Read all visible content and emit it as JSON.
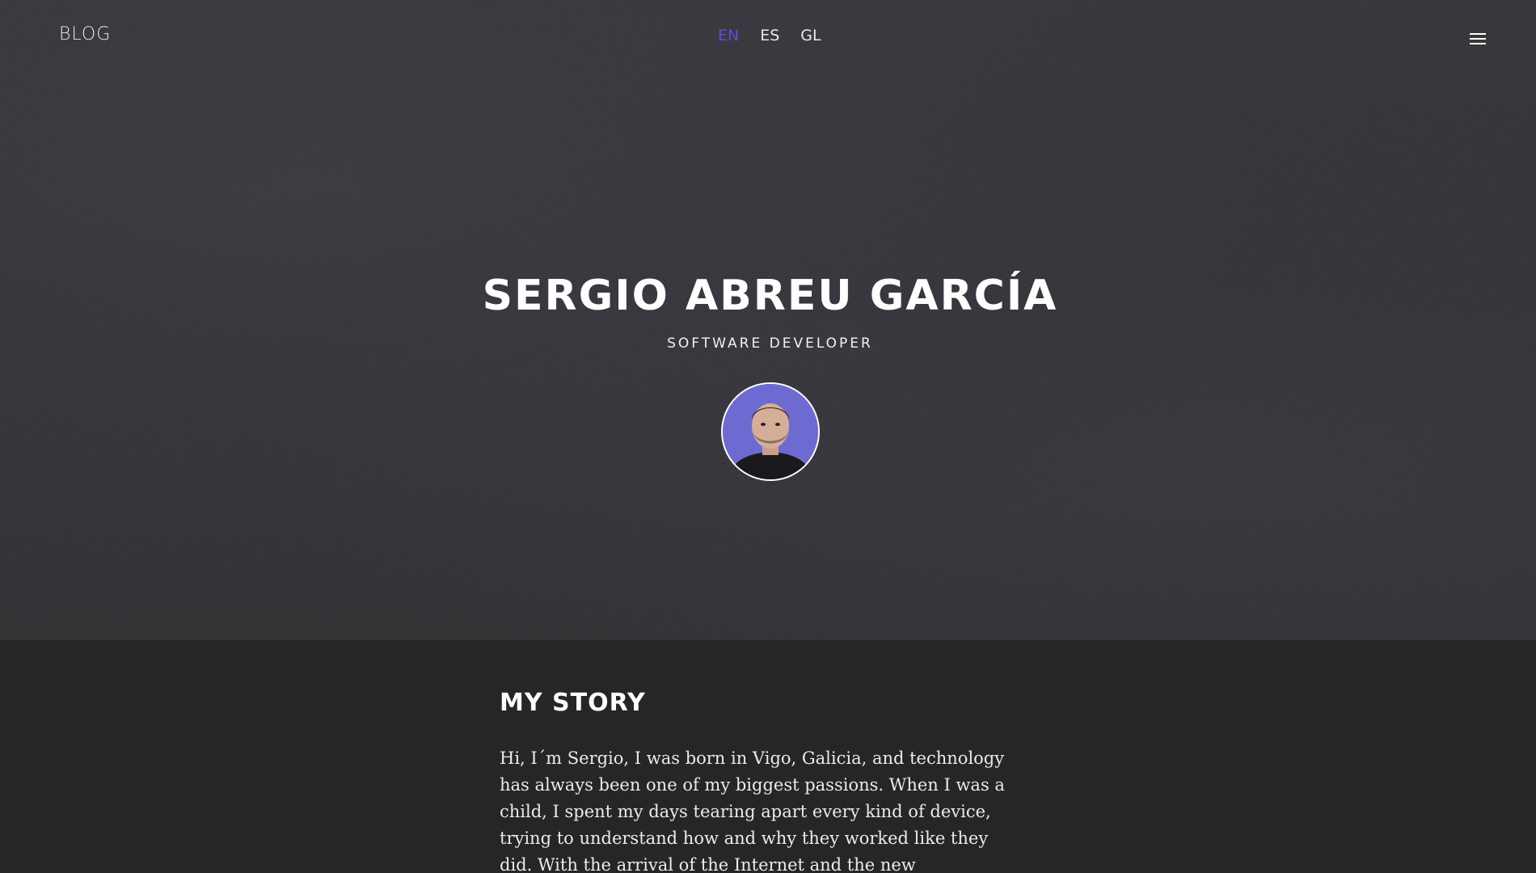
{
  "nav": {
    "logo": "BLOG",
    "languages": [
      "EN",
      "ES",
      "GL"
    ],
    "active_language": "EN",
    "menu_icon": "hamburger-menu-icon"
  },
  "hero": {
    "title": "SERGIO ABREU GARCÍA",
    "subtitle": "SOFTWARE DEVELOPER"
  },
  "story": {
    "heading": "MY STORY",
    "paragraph": "Hi, I´m Sergio, I was born in Vigo, Galicia, and technology has always been one of my biggest passions. When I was a child, I spent my days tearing apart every kind of device, trying to understand how and why they worked like they did. With the arrival of the Internet and the new technologies, that curiosity"
  },
  "colors": {
    "accent": "#5a4fd6",
    "hero_background": "#2c2b2f",
    "content_background": "#262527",
    "avatar_background": "#6d6ad1"
  }
}
